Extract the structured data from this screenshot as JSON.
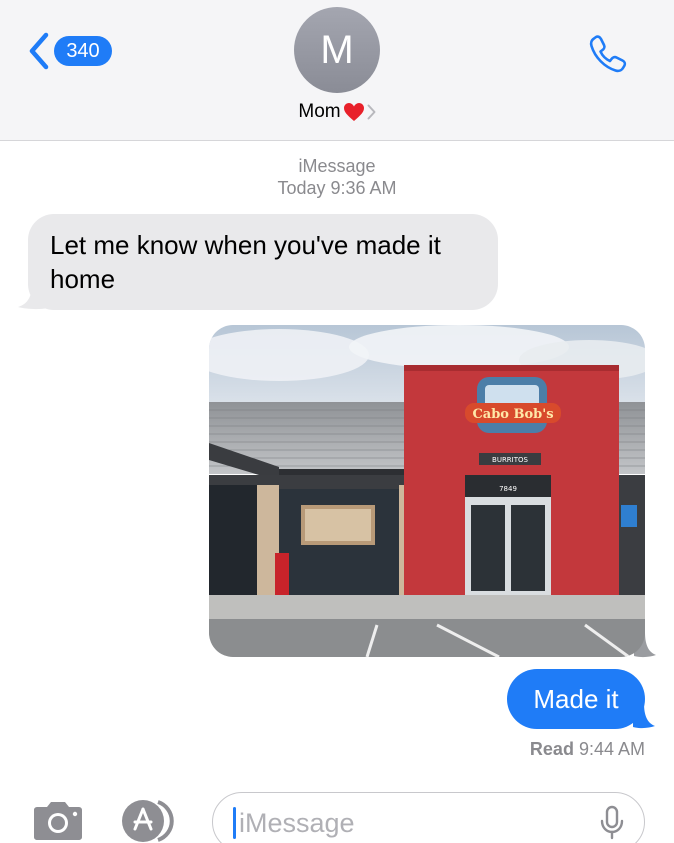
{
  "header": {
    "back_count": "340",
    "avatar_initial": "M",
    "contact_name": "Mom"
  },
  "thread": {
    "service": "iMessage",
    "timestamp": "Today 9:36 AM",
    "incoming_text": "Let me know when you've made it home",
    "photo": {
      "sign_name": "Cabo Bob's",
      "sign_subtitle": "BURRITOS",
      "address_number": "7849"
    },
    "outgoing_text": "Made it",
    "receipt_label": "Read",
    "receipt_time": "9:44 AM"
  },
  "input": {
    "placeholder": "iMessage"
  },
  "icons": {
    "back": "chevron-left-icon",
    "phone": "phone-icon",
    "camera": "camera-icon",
    "apps": "app-store-icon",
    "mic": "microphone-icon"
  },
  "colors": {
    "accent": "#1f7cf7",
    "incoming_bubble": "#e9e9eb",
    "header_bg": "#f5f5f7",
    "meta_text": "#8a8a8e"
  }
}
